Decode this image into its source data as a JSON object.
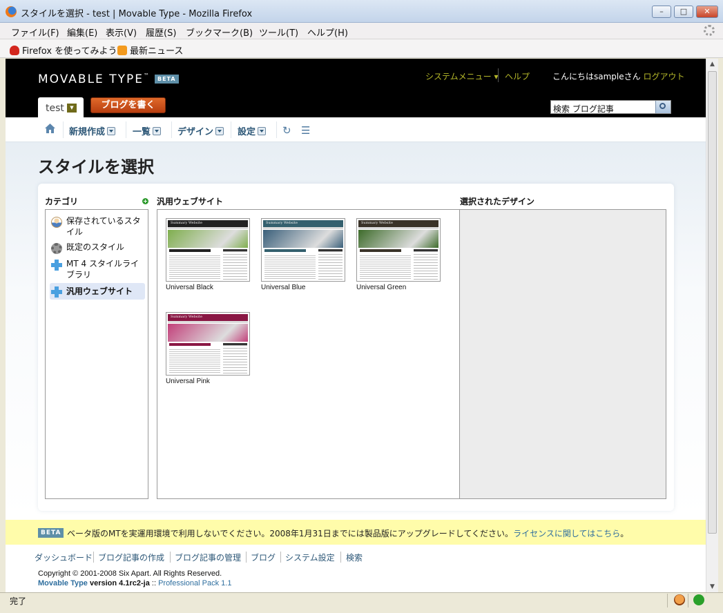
{
  "window": {
    "title": "スタイルを選択 - test | Movable Type - Mozilla Firefox",
    "min": "–",
    "max": "□",
    "close": "✕"
  },
  "menubar": [
    "ファイル(F)",
    "編集(E)",
    "表示(V)",
    "履歴(S)",
    "ブックマーク(B)",
    "ツール(T)",
    "ヘルプ(H)"
  ],
  "bookmarks": [
    "Firefox を使ってみよう",
    "最新ニュース"
  ],
  "mt": {
    "logo": "MOVABLE TYPE",
    "tm": "™",
    "beta": "BETA",
    "system_menu": "システムメニュー ▾",
    "help": "ヘルプ",
    "greeting": "こんにちはsampleさん",
    "logout": "ログアウト",
    "blog_name": "test",
    "blog_dd": "▼",
    "write_button": "ブログを書く",
    "search_value": "検索 ブログ記事"
  },
  "nav": {
    "items": [
      "新規作成",
      "一覧",
      "デザイン",
      "設定"
    ],
    "refresh_icon": "↻",
    "list_icon": "☰"
  },
  "page": {
    "title": "スタイルを選択",
    "categories_head": "カテゴリ",
    "themes_head": "汎用ウェブサイト",
    "selected_head": "選択されたデザイン",
    "categories": [
      {
        "label": "保存されているスタイル",
        "icon": "user-icon"
      },
      {
        "label": "既定のスタイル",
        "icon": "gear-icon"
      },
      {
        "label": "MT 4 スタイルライブラリ",
        "icon": "plus-icon"
      },
      {
        "label": "汎用ウェブサイト",
        "icon": "plus-icon",
        "selected": true
      }
    ],
    "themes": [
      {
        "label": "Universal Black",
        "color": "#222222",
        "hero": "#7fae4e"
      },
      {
        "label": "Universal Blue",
        "color": "#34606e",
        "hero": "#3a5f7a"
      },
      {
        "label": "Universal Green",
        "color": "#3a3328",
        "hero": "#3d6b2a"
      },
      {
        "label": "Universal Pink",
        "color": "#8a1744",
        "hero": "#c2407a"
      }
    ],
    "thumb_site_title": "Summary Website"
  },
  "beta_bar": {
    "badge": "BETA",
    "message": "ベータ版のMTを実運用環境で利用しないでください。2008年1月31日までには製品版にアップグレードしてください。",
    "link": "ライセンスに関してはこちら",
    "end": "。"
  },
  "footer": {
    "links": [
      "ダッシュボード",
      "ブログ記事の作成",
      "ブログ記事の管理",
      "ブログ",
      "システム設定",
      "検索"
    ],
    "copyright": "Copyright © 2001-2008 Six Apart. All Rights Reserved.",
    "mt": "Movable Type",
    "version": " version 4.1rc2-ja",
    "sep": " :: ",
    "pro": "Professional Pack 1.1"
  },
  "status": {
    "text": "完了"
  },
  "colors": {
    "accent": "#b6b92a",
    "link": "#2e5878",
    "header_bg": "#000000",
    "beta_bg": "#fffcaa"
  }
}
